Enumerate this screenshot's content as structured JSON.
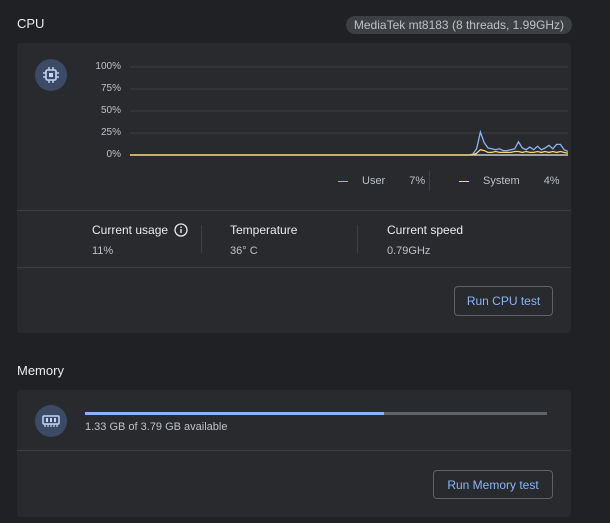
{
  "cpu": {
    "title": "CPU",
    "device": "MediaTek mt8183 (8 threads, 1.99GHz)",
    "chart_data": {
      "type": "line",
      "yticks": [
        "100%",
        "75%",
        "50%",
        "25%",
        "0%"
      ],
      "ylim": [
        0,
        100
      ],
      "series": [
        {
          "name": "User",
          "color": "#8ab4f8",
          "values": [
            0,
            0,
            0,
            0,
            0,
            0,
            0,
            0,
            0,
            0,
            0,
            0,
            0,
            0,
            0,
            0,
            0,
            0,
            0,
            0,
            0,
            0,
            0,
            0,
            0,
            0,
            0,
            0,
            0,
            0,
            0,
            0,
            0,
            0,
            0,
            0,
            0,
            0,
            0,
            0,
            0,
            0,
            0,
            0,
            0,
            0,
            0,
            0,
            0,
            0,
            0,
            0,
            0,
            0,
            0,
            0,
            0,
            0,
            0,
            0,
            0,
            0,
            0,
            0,
            0,
            0,
            0,
            0,
            0,
            0,
            0,
            0,
            0,
            0,
            0,
            0,
            0,
            0,
            0,
            0,
            0,
            0,
            0,
            0,
            0,
            0,
            0,
            0,
            0,
            0,
            1,
            7,
            26,
            14,
            8,
            7,
            6,
            7,
            5,
            5,
            6,
            7,
            15,
            8,
            6,
            9,
            6,
            10,
            6,
            8,
            11,
            7,
            12,
            12,
            6,
            4
          ]
        },
        {
          "name": "System",
          "color": "#fdd663",
          "values": [
            0,
            0,
            0,
            0,
            0,
            0,
            0,
            0,
            0,
            0,
            0,
            0,
            0,
            0,
            0,
            0,
            0,
            0,
            0,
            0,
            0,
            0,
            0,
            0,
            0,
            0,
            0,
            0,
            0,
            0,
            0,
            0,
            0,
            0,
            0,
            0,
            0,
            0,
            0,
            0,
            0,
            0,
            0,
            0,
            0,
            0,
            0,
            0,
            0,
            0,
            0,
            0,
            0,
            0,
            0,
            0,
            0,
            0,
            0,
            0,
            0,
            0,
            0,
            0,
            0,
            0,
            0,
            0,
            0,
            0,
            0,
            0,
            0,
            0,
            0,
            0,
            0,
            0,
            0,
            0,
            0,
            0,
            0,
            0,
            0,
            0,
            0,
            0,
            0,
            0,
            0,
            2,
            6,
            5,
            3,
            3,
            4,
            3,
            3,
            3,
            3,
            4,
            4,
            3,
            4,
            3,
            3,
            4,
            3,
            4,
            3,
            4,
            3,
            4,
            3,
            2
          ]
        }
      ]
    },
    "legend": [
      {
        "label": "User",
        "value": "7%",
        "color": "#8ab4f8"
      },
      {
        "label": "System",
        "value": "4%",
        "color": "#fdd663"
      }
    ],
    "stats": [
      {
        "label": "Current usage",
        "value": "11%"
      },
      {
        "label": "Temperature",
        "value": "36° C"
      },
      {
        "label": "Current speed",
        "value": "0.79GHz"
      }
    ],
    "run_button": "Run CPU test"
  },
  "memory": {
    "title": "Memory",
    "progress_fraction": 0.648,
    "available_text": "1.33 GB of 3.79 GB available",
    "run_button": "Run Memory test"
  },
  "colors": {
    "accent": "#8ab4f8",
    "system": "#fdd663",
    "background": "#202124",
    "card": "#292a2d"
  }
}
